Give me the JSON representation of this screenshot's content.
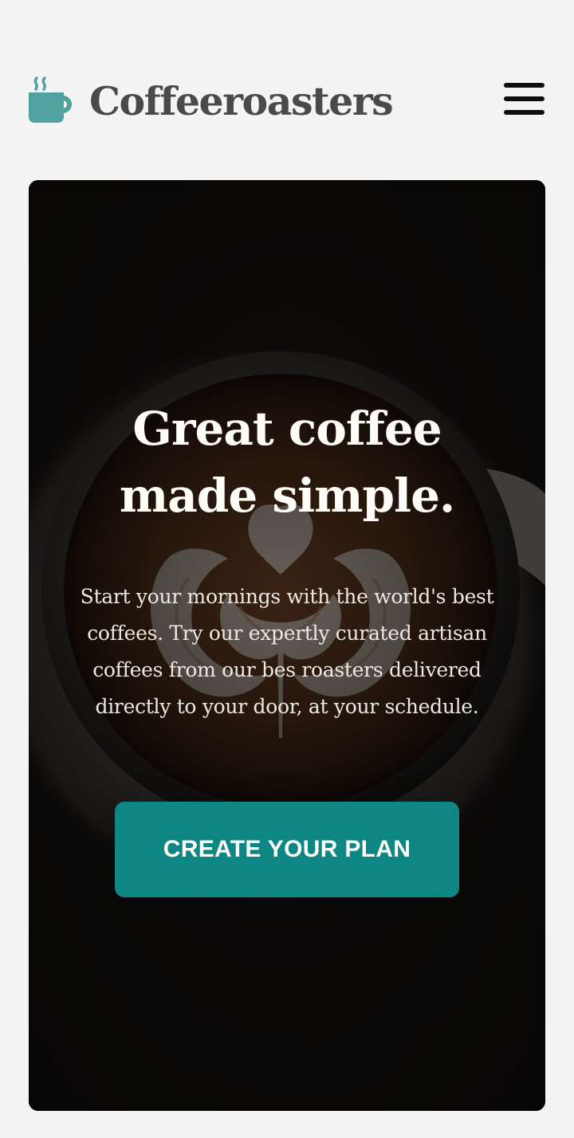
{
  "brand": {
    "name": "Coffeeroasters",
    "logo_icon": "coffee-cup-icon",
    "accent_color": "#4fa2a0",
    "text_color": "#4a4a4a"
  },
  "nav": {
    "menu_icon": "hamburger-menu-icon"
  },
  "hero": {
    "title_line1": "Great coffee",
    "title_line2": "made simple.",
    "description": "Start your mornings with the world's best coffees. Try our expertly curated artisan coffees from our bes roasters delivered directly to your door, at your schedule.",
    "background_image": "latte-art-coffee-cup",
    "cta_label": "CREATE YOUR PLAN",
    "cta_color": "#0e8784"
  }
}
